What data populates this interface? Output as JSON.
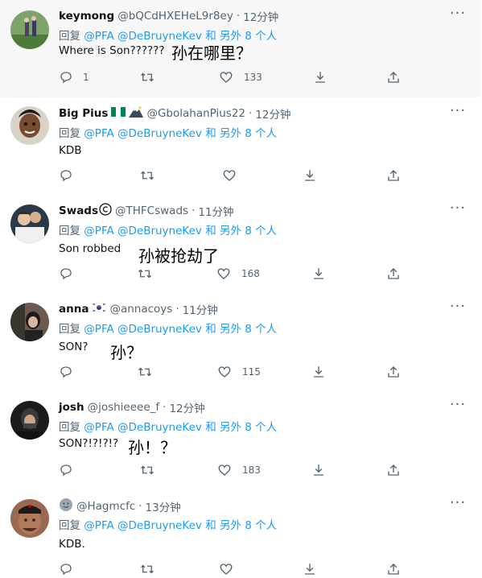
{
  "tweets": [
    {
      "name": "keymong",
      "badges": "",
      "handle": "@bQCdHXEHeL9r8ey",
      "time": "12分钟",
      "reply_prefix": "回复",
      "reply_to": "@PFA @DeBruyneKev",
      "reply_suffix": "和 另外 8 个人",
      "text": "Where is Son??????",
      "note": "孙在哪里？",
      "replies": "1",
      "retweets": "",
      "likes": "133"
    },
    {
      "name": "Big Pius",
      "badges": "flag-nigeria mountain",
      "handle": "@GbolahanPius22",
      "time": "12分钟",
      "reply_prefix": "回复",
      "reply_to": "@PFA @DeBruyneKev",
      "reply_suffix": "和 另外 8 个人",
      "text": "KDB",
      "note": "",
      "replies": "",
      "retweets": "",
      "likes": ""
    },
    {
      "name": "Swads",
      "badges": "copyright-circle",
      "handle": "@THFCswads",
      "time": "11分钟",
      "reply_prefix": "回复",
      "reply_to": "@PFA @DeBruyneKev",
      "reply_suffix": "和 另外 8 个人",
      "text": "Son robbed",
      "note": "孙被抢劫了",
      "replies": "",
      "retweets": "",
      "likes": "168"
    },
    {
      "name": "anna",
      "badges": "flag-south-korea",
      "handle": "@annacoys",
      "time": "11分钟",
      "reply_prefix": "回复",
      "reply_to": "@PFA @DeBruyneKev",
      "reply_suffix": "和 另外 8 个人",
      "text": "SON?",
      "note": "孙？",
      "replies": "",
      "retweets": "",
      "likes": "115"
    },
    {
      "name": "josh",
      "badges": "",
      "handle": "@joshieeee_f",
      "time": "12分钟",
      "reply_prefix": "回复",
      "reply_to": "@PFA @DeBruyneKev",
      "reply_suffix": "和 另外 8 个人",
      "text": "SON?!?!?!?",
      "note": "孙！？",
      "replies": "",
      "retweets": "",
      "likes": "183"
    },
    {
      "name": "",
      "badges": "smiley",
      "handle": "@Hagmcfc",
      "time": "13分钟",
      "reply_prefix": "回复",
      "reply_to": "@PFA @DeBruyneKev",
      "reply_suffix": "和 另外 8 个人",
      "text": "KDB.",
      "note": "",
      "replies": "",
      "retweets": "",
      "likes": ""
    }
  ],
  "icons": {
    "reply": "reply-icon",
    "retweet": "retweet-icon",
    "like": "heart-icon",
    "share": "share-icon",
    "more": "more-icon"
  },
  "colors": {
    "link": "#1d9bf0",
    "muted": "#536471",
    "highlight": "#f7f7f7"
  }
}
